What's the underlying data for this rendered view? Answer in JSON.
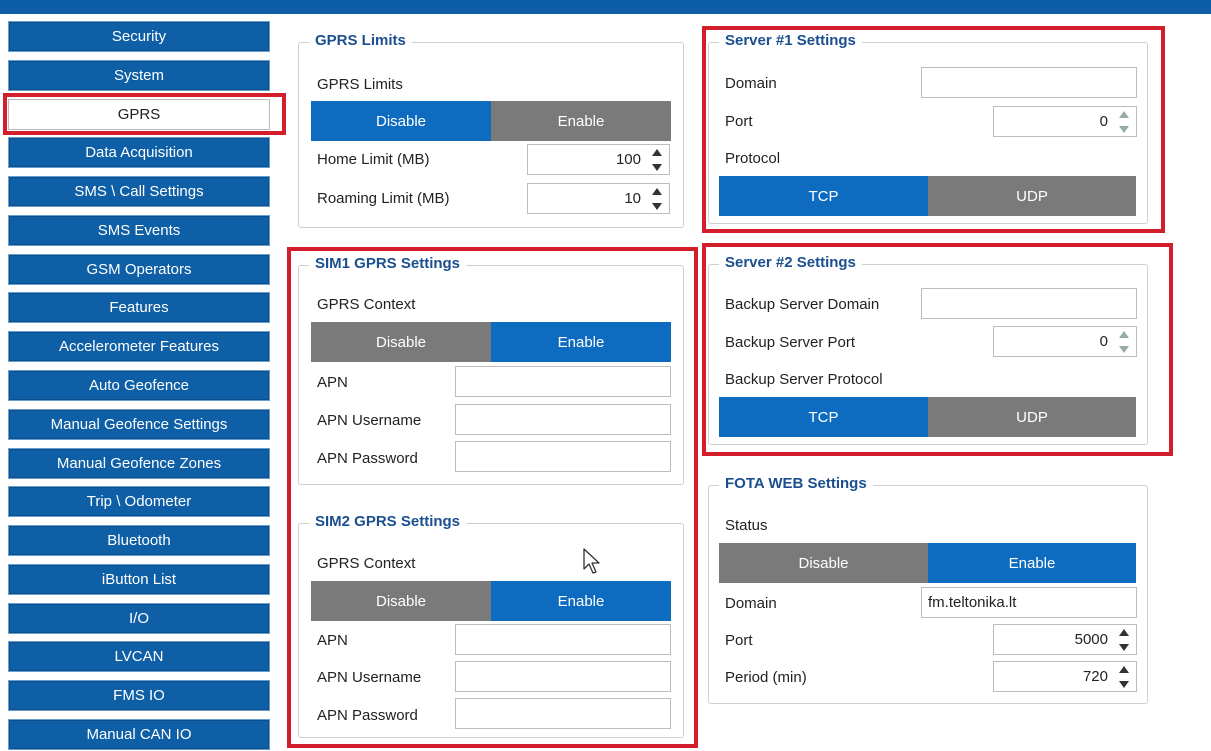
{
  "sidebar": {
    "items": [
      {
        "label": "Security"
      },
      {
        "label": "System"
      },
      {
        "label": "GPRS"
      },
      {
        "label": "Data Acquisition"
      },
      {
        "label": "SMS \\ Call Settings"
      },
      {
        "label": "SMS Events"
      },
      {
        "label": "GSM Operators"
      },
      {
        "label": "Features"
      },
      {
        "label": "Accelerometer Features"
      },
      {
        "label": "Auto Geofence"
      },
      {
        "label": "Manual Geofence Settings"
      },
      {
        "label": "Manual Geofence Zones"
      },
      {
        "label": "Trip \\ Odometer"
      },
      {
        "label": "Bluetooth"
      },
      {
        "label": "iButton List"
      },
      {
        "label": "I/O"
      },
      {
        "label": "LVCAN"
      },
      {
        "label": "FMS IO"
      },
      {
        "label": "Manual CAN IO"
      }
    ],
    "active_index": 2
  },
  "gprs_limits": {
    "title": "GPRS Limits",
    "field_label": "GPRS Limits",
    "disable": "Disable",
    "enable": "Enable",
    "home_label": "Home Limit (MB)",
    "home_value": "100",
    "roaming_label": "Roaming Limit (MB)",
    "roaming_value": "10"
  },
  "sim1": {
    "title": "SIM1 GPRS Settings",
    "context_label": "GPRS Context",
    "disable": "Disable",
    "enable": "Enable",
    "apn_label": "APN",
    "apn_value": "",
    "user_label": "APN Username",
    "user_value": "",
    "pass_label": "APN Password",
    "pass_value": ""
  },
  "sim2": {
    "title": "SIM2 GPRS Settings",
    "context_label": "GPRS Context",
    "disable": "Disable",
    "enable": "Enable",
    "apn_label": "APN",
    "apn_value": "",
    "user_label": "APN Username",
    "user_value": "",
    "pass_label": "APN Password",
    "pass_value": ""
  },
  "server1": {
    "title": "Server #1 Settings",
    "domain_label": "Domain",
    "domain_value": "",
    "port_label": "Port",
    "port_value": "0",
    "protocol_label": "Protocol",
    "tcp": "TCP",
    "udp": "UDP"
  },
  "server2": {
    "title": "Server #2 Settings",
    "domain_label": "Backup Server Domain",
    "domain_value": "",
    "port_label": "Backup Server Port",
    "port_value": "0",
    "protocol_label": "Backup Server Protocol",
    "tcp": "TCP",
    "udp": "UDP"
  },
  "fota": {
    "title": "FOTA WEB Settings",
    "status_label": "Status",
    "disable": "Disable",
    "enable": "Enable",
    "domain_label": "Domain",
    "domain_value": "fm.teltonika.lt",
    "port_label": "Port",
    "port_value": "5000",
    "period_label": "Period (min)",
    "period_value": "720"
  },
  "colors": {
    "nav_bg": "#0e5fa6",
    "toggle_on": "#0e6cc0",
    "toggle_off": "#7a7a7a",
    "highlight": "#d21f2b",
    "group_title": "#1b4f8f"
  }
}
